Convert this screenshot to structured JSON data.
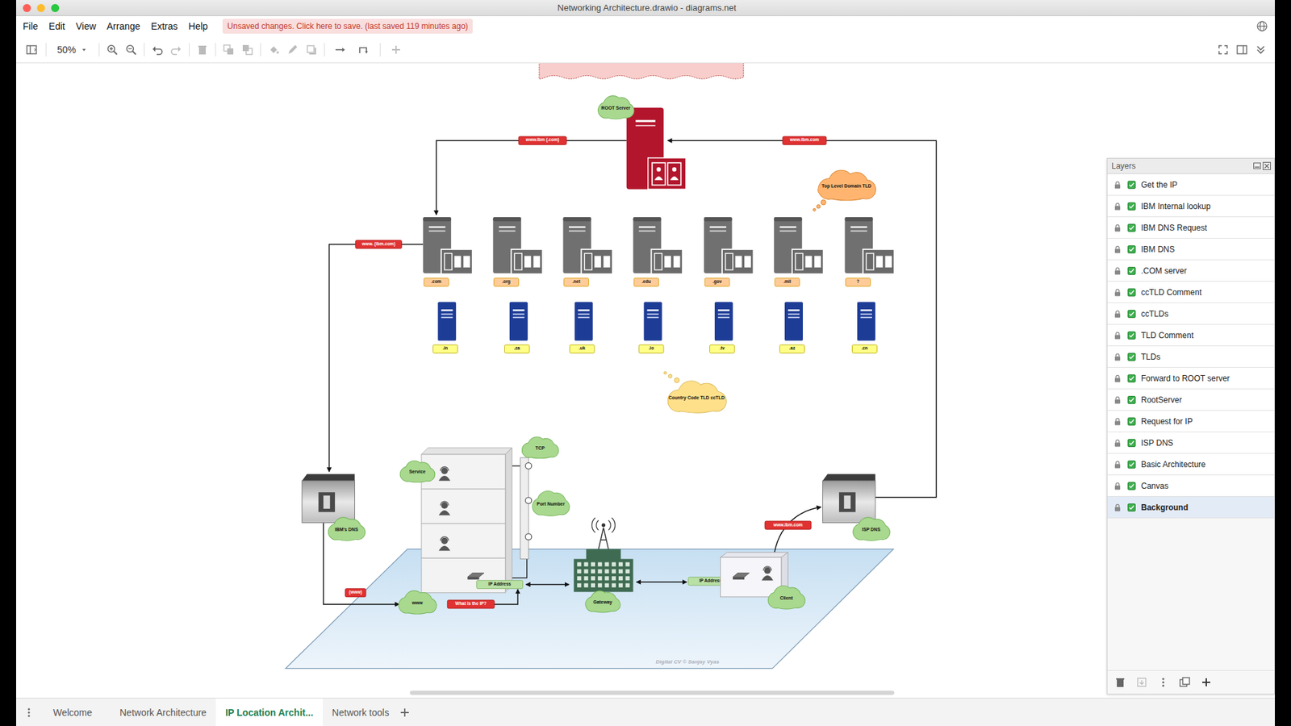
{
  "window": {
    "title": "Networking Architecture.drawio - diagrams.net"
  },
  "menu": [
    "File",
    "Edit",
    "View",
    "Arrange",
    "Extras",
    "Help"
  ],
  "unsaved_notice": "Unsaved changes. Click here to save. (last saved 119 minutes ago)",
  "toolbar": {
    "zoom": "50%"
  },
  "diagram": {
    "root_server": "ROOT Server",
    "root_links": [
      "www.ibm (.com)",
      "www.ibm.com"
    ],
    "tld_servers": [
      ".com",
      ".org",
      ".net",
      ".edu",
      ".gov",
      ".mil",
      "?"
    ],
    "cctld_servers": [
      ".in",
      ".za",
      ".uk",
      ".io",
      ".tv",
      ".az",
      ".cn"
    ],
    "tld_comment": "Top Level Domain TLD",
    "cctld_comment": "Country Code TLD ccTLD",
    "tld_link": "www. (ibm.com)",
    "ibm_dns": "IBM's DNS",
    "isp_dns": "ISP DNS",
    "www_link": "(www)",
    "www": "www",
    "what_ip": "What is the IP?",
    "service": "Service",
    "tcp": "TCP",
    "port": "Port Number",
    "ip_left": "IP Address",
    "ip_right": "IP Address",
    "gateway": "Gateway",
    "client": "Client",
    "client_link": "www.ibm.com",
    "watermark": "Digital CV © Sanjay Vyas"
  },
  "layers": {
    "title": "Layers",
    "items": [
      {
        "name": "Get the IP",
        "visible": true,
        "selected": false
      },
      {
        "name": "IBM Internal lookup",
        "visible": true,
        "selected": false
      },
      {
        "name": "IBM DNS Request",
        "visible": true,
        "selected": false
      },
      {
        "name": "IBM DNS",
        "visible": true,
        "selected": false
      },
      {
        "name": ".COM server",
        "visible": true,
        "selected": false
      },
      {
        "name": "ccTLD Comment",
        "visible": true,
        "selected": false
      },
      {
        "name": "ccTLDs",
        "visible": true,
        "selected": false
      },
      {
        "name": "TLD Comment",
        "visible": true,
        "selected": false
      },
      {
        "name": "TLDs",
        "visible": true,
        "selected": false
      },
      {
        "name": "Forward to ROOT server",
        "visible": true,
        "selected": false
      },
      {
        "name": "RootServer",
        "visible": true,
        "selected": false
      },
      {
        "name": "Request for IP",
        "visible": true,
        "selected": false
      },
      {
        "name": "ISP DNS",
        "visible": true,
        "selected": false
      },
      {
        "name": "Basic Architecture",
        "visible": true,
        "selected": false
      },
      {
        "name": "Canvas",
        "visible": true,
        "selected": false
      },
      {
        "name": "Background",
        "visible": true,
        "selected": true
      }
    ]
  },
  "pages": [
    {
      "label": "Welcome",
      "selected": false
    },
    {
      "label": "Network Architecture",
      "selected": false
    },
    {
      "label": "IP Location Archit...",
      "selected": true
    },
    {
      "label": "Network tools",
      "selected": false
    }
  ]
}
